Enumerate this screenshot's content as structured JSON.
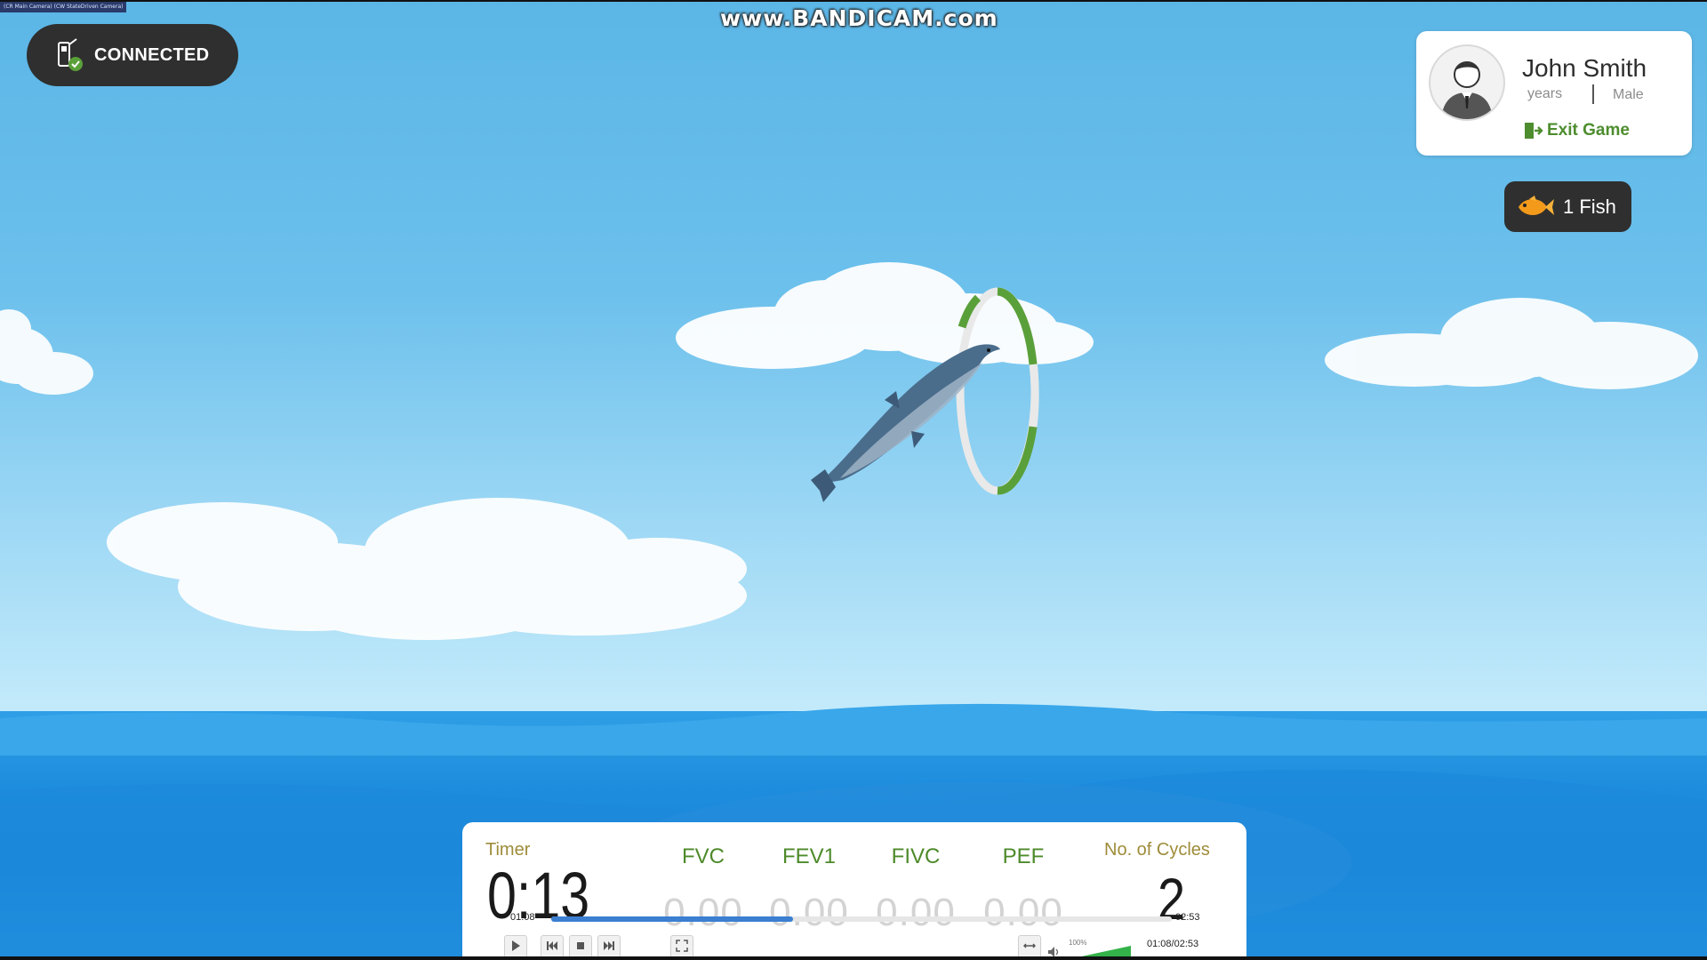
{
  "recorder": {
    "window_label": "(CR Main Camera) (CW StateDriven Camera)",
    "watermark": "www.BANDICAM.com"
  },
  "connection": {
    "status": "CONNECTED"
  },
  "player": {
    "name": "John Smith",
    "age_label": "years",
    "gender": "Male",
    "exit_label": "Exit Game"
  },
  "fish": {
    "count_label": "1 Fish"
  },
  "stats": {
    "timer_label": "Timer",
    "timer_value": "0:13",
    "metrics": [
      {
        "name": "FVC",
        "value": "0.00"
      },
      {
        "name": "FEV1",
        "value": "0.00"
      },
      {
        "name": "FIVC",
        "value": "0.00"
      },
      {
        "name": "PEF",
        "value": "0.00"
      }
    ],
    "cycles_label": "No. of Cycles",
    "cycles_value": "2"
  },
  "media_player": {
    "current_time": "01:08",
    "total_time": "02:53",
    "progress_fraction": 0.39,
    "volume_label": "100%",
    "time_display": "01:08/02:53"
  },
  "colors": {
    "accent_green": "#4d8a2a",
    "badge_dark": "#2f2f2f",
    "fish_orange": "#f39a1b",
    "seek_blue": "#3a7fd1"
  },
  "icons": {
    "connection": "device-check-icon",
    "exit": "exit-door-icon",
    "fish": "fish-icon",
    "avatar": "user-avatar-icon"
  }
}
